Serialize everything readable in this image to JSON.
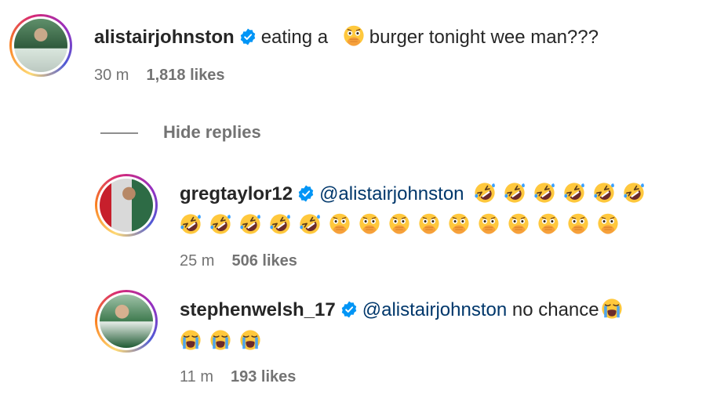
{
  "comment": {
    "username": "alistairjohnston",
    "text_before": "eating a",
    "text_after": "burger tonight wee man???",
    "time": "30 m",
    "likes": "1,818 likes"
  },
  "hide_replies_label": "Hide replies",
  "replies": [
    {
      "username": "gregtaylor12",
      "mention": "@alistairjohnston",
      "time": "25 m",
      "likes": "506 likes"
    },
    {
      "username": "stephenwelsh_17",
      "mention": "@alistairjohnston",
      "text": "no chance",
      "time": "11 m",
      "likes": "193 likes"
    }
  ],
  "icons": {
    "verified": "verified-badge-icon",
    "rofl": "rolling-on-floor-laughing-emoji",
    "shushing": "face-with-hand-over-mouth-emoji",
    "crying": "loudly-crying-face-emoji"
  },
  "colors": {
    "mention": "#00376b",
    "verified": "#0095f6",
    "meta_text": "#737373"
  }
}
